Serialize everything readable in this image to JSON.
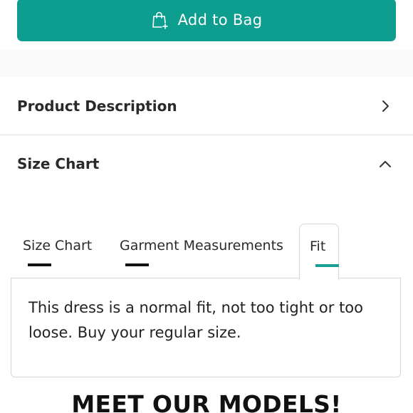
{
  "add_to_bag": {
    "label": "Add to Bag",
    "icon": "shopping-bag-plus-icon",
    "color": "#0e9e90"
  },
  "accordion": {
    "product_description": {
      "label": "Product Description",
      "icon": "chevron-right-icon"
    },
    "size_chart": {
      "label": "Size Chart",
      "icon": "chevron-up-icon",
      "expanded": true
    }
  },
  "tabs": [
    {
      "label": "Size Chart",
      "active": false
    },
    {
      "label": "Garment Measurements",
      "active": false
    },
    {
      "label": "Fit",
      "active": true
    }
  ],
  "fit_panel": {
    "text": "This dress is a normal fit, not too tight or too loose. Buy your regular size."
  },
  "models_section": {
    "heading": "MEET OUR MODELS!"
  },
  "colors": {
    "accent": "#0e9e90",
    "active_tab_underline": "#1a9e91",
    "inactive_tab_underline": "#111111"
  }
}
